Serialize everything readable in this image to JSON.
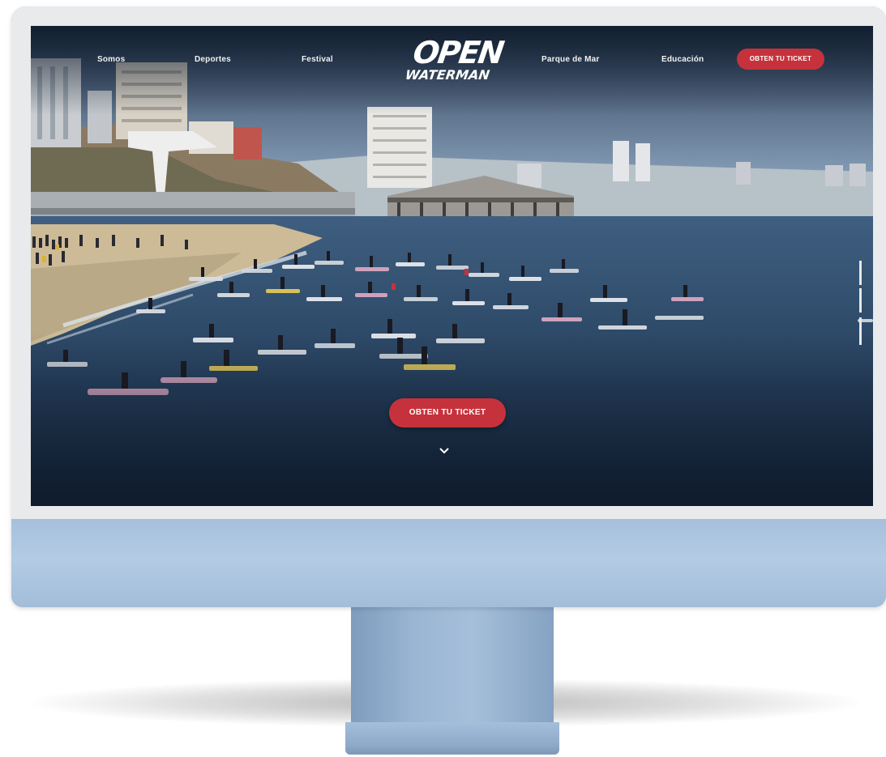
{
  "nav": {
    "items": [
      {
        "label": "Somos"
      },
      {
        "label": "Deportes"
      },
      {
        "label": "Festival"
      },
      {
        "label": "Parque de Mar"
      },
      {
        "label": "Educación"
      }
    ],
    "logo_top": "OPEN",
    "logo_bottom": "WATERMAN",
    "cta_label": "OBTEN TU TICKET"
  },
  "hero": {
    "cta_label": "OBTEN TU TICKET",
    "scroll_icon": "chevron-down-icon"
  },
  "colors": {
    "accent": "#c6323c",
    "monitor": "#a6c0dc",
    "bezel": "#e9eaec"
  }
}
